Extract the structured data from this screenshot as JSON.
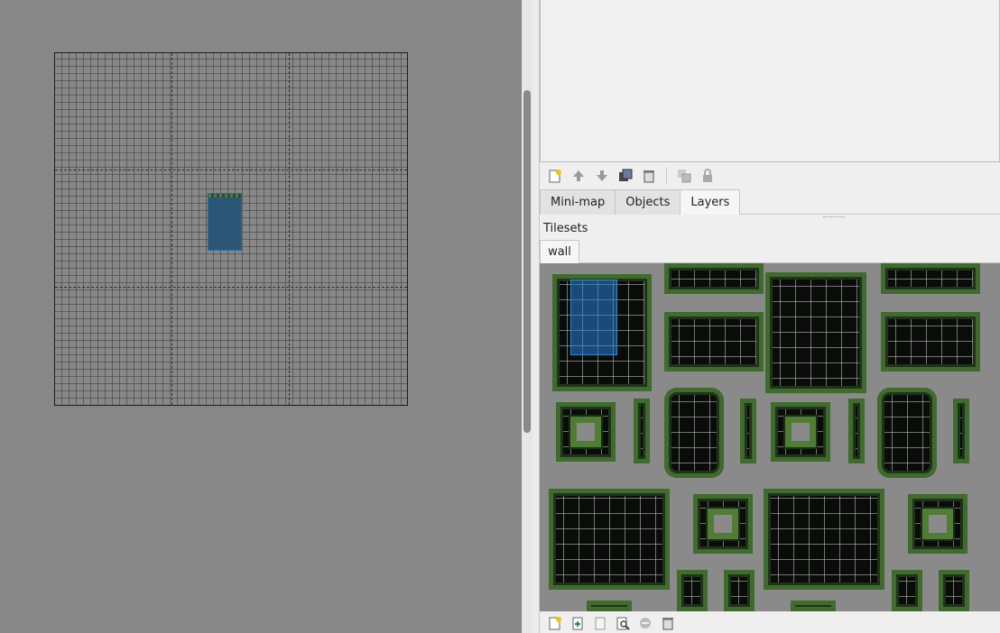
{
  "map": {
    "major_grid_columns": 3,
    "major_grid_rows": 3
  },
  "layer_toolbar": {
    "icons": [
      "new-layer-icon",
      "raise-layer-icon",
      "lower-layer-icon",
      "duplicate-layer-icon",
      "delete-layer-icon",
      "show-other-layers-icon",
      "lock-layer-icon"
    ]
  },
  "dock_tabs": [
    {
      "label": "Mini-map"
    },
    {
      "label": "Objects"
    },
    {
      "label": "Layers"
    }
  ],
  "tilesets": {
    "title": "Tilesets",
    "tabs": [
      {
        "label": "wall"
      }
    ]
  },
  "tileset_toolbar": {
    "icons": [
      "new-tileset-icon",
      "import-tileset-icon",
      "export-tileset-icon",
      "tileset-properties-icon",
      "edit-terrain-icon",
      "remove-tileset-icon"
    ]
  },
  "colors": {
    "canvas_bg": "#878787",
    "selection": "#2b8ad6",
    "foliage": "#4f7d34",
    "panel_bg": "#efefef"
  }
}
